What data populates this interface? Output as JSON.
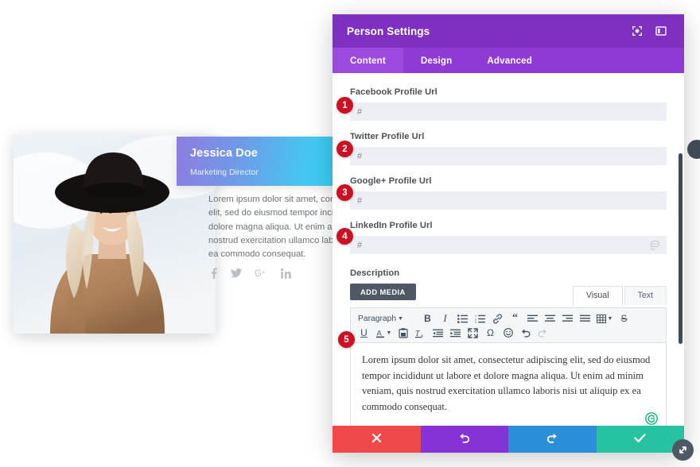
{
  "preview": {
    "name": "Jessica Doe",
    "role": "Marketing Director",
    "body_lines": [
      "Lorem ipsum dolor sit amet, cons",
      "elit, sed do eiusmod tempor incid",
      "dolore magna aliqua. Ut enim ad",
      "nostrud exercitation ullamco lab",
      "ea commodo consequat."
    ],
    "socials": [
      {
        "name": "facebook-icon",
        "glyph": "f"
      },
      {
        "name": "twitter-icon",
        "glyph": "t"
      },
      {
        "name": "googleplus-icon",
        "glyph": "G+"
      },
      {
        "name": "linkedin-icon",
        "glyph": "in"
      }
    ],
    "banner_gradient_from": "#8e7ce0",
    "banner_gradient_to": "#35d0f5"
  },
  "modal": {
    "title": "Person Settings",
    "header_color": "#7e30c1",
    "tabbar_color": "#8f3ad4",
    "header_icons": [
      {
        "name": "fullscreen-icon"
      },
      {
        "name": "layout-panel-icon"
      }
    ],
    "tabs": [
      {
        "label": "Content",
        "active": true
      },
      {
        "label": "Design",
        "active": false
      },
      {
        "label": "Advanced",
        "active": false
      }
    ],
    "fields": [
      {
        "label": "Facebook Profile Url",
        "value": "#",
        "badge": "1",
        "has_dynamic_icon": false
      },
      {
        "label": "Twitter Profile Url",
        "value": "#",
        "badge": "2",
        "has_dynamic_icon": false
      },
      {
        "label": "Google+ Profile Url",
        "value": "#",
        "badge": "3",
        "has_dynamic_icon": false
      },
      {
        "label": "LinkedIn Profile Url",
        "value": "#",
        "badge": "4",
        "has_dynamic_icon": true
      }
    ],
    "description": {
      "label": "Description",
      "badge": "5",
      "add_media_label": "ADD MEDIA",
      "editor_modes": [
        {
          "label": "Visual",
          "active": true
        },
        {
          "label": "Text",
          "active": false
        }
      ],
      "toolbar_row1": [
        {
          "name": "paragraph-format-select",
          "label": "Paragraph",
          "type": "select"
        },
        {
          "name": "bold-icon",
          "label": "B",
          "type": "bold"
        },
        {
          "name": "italic-icon",
          "label": "I",
          "type": "italic"
        },
        {
          "name": "bullet-list-icon",
          "type": "ul"
        },
        {
          "name": "numbered-list-icon",
          "type": "ol"
        },
        {
          "name": "link-icon",
          "type": "link"
        },
        {
          "name": "blockquote-icon",
          "label": "“",
          "type": "quote"
        },
        {
          "name": "align-left-icon",
          "type": "align-left"
        },
        {
          "name": "align-center-icon",
          "type": "align-center"
        },
        {
          "name": "align-right-icon",
          "type": "align-right"
        },
        {
          "name": "align-justify-icon",
          "type": "align-justify"
        },
        {
          "name": "table-icon",
          "type": "table"
        },
        {
          "name": "strikethrough-icon",
          "label": "S",
          "type": "strike"
        }
      ],
      "toolbar_row2": [
        {
          "name": "underline-icon",
          "label": "U",
          "type": "underline"
        },
        {
          "name": "text-color-icon",
          "label": "A",
          "type": "textcolor"
        },
        {
          "name": "paste-as-text-icon",
          "type": "paste"
        },
        {
          "name": "clear-formatting-icon",
          "type": "clearfmt"
        },
        {
          "name": "outdent-icon",
          "type": "outdent"
        },
        {
          "name": "indent-icon",
          "type": "indent"
        },
        {
          "name": "fullscreen-editor-icon",
          "type": "expand"
        },
        {
          "name": "special-character-icon",
          "label": "Ω",
          "type": "omega"
        },
        {
          "name": "emoji-icon",
          "type": "emoji"
        },
        {
          "name": "undo-icon",
          "type": "undo"
        },
        {
          "name": "redo-icon",
          "type": "redo"
        }
      ],
      "content": "Lorem ipsum dolor sit amet, consectetur adipiscing elit, sed do eiusmod tempor incididunt ut labore et dolore magna aliqua. Ut enim ad minim veniam, quis nostrud exercitation ullamco laboris nisi ut aliquip ex ea commodo consequat.",
      "grammar_icon": "grammarly-icon"
    },
    "footer_buttons": [
      {
        "name": "discard-button",
        "icon": "close-icon",
        "color": "#ef4a4a"
      },
      {
        "name": "undo-button",
        "icon": "undo-icon",
        "color": "#8433d4"
      },
      {
        "name": "redo-button",
        "icon": "redo-icon",
        "color": "#2b8fd8"
      },
      {
        "name": "save-button",
        "icon": "check-icon",
        "color": "#27c3a0"
      }
    ],
    "resize_handle": "resize-handle-icon",
    "scrollbar": "vertical-scrollbar"
  }
}
